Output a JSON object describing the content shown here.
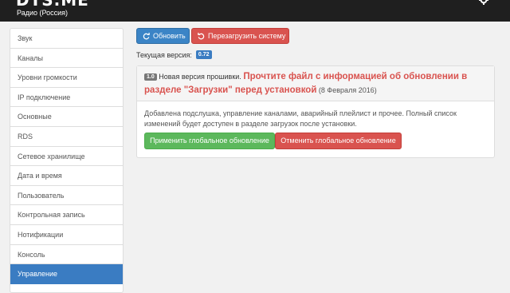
{
  "header": {
    "brand": "DTS.ME",
    "subtitle": "Радио (Россия)"
  },
  "sidebar": {
    "items": [
      {
        "label": "Звук"
      },
      {
        "label": "Каналы"
      },
      {
        "label": "Уровни громкости"
      },
      {
        "label": "IP подключение"
      },
      {
        "label": "Основные"
      },
      {
        "label": "RDS"
      },
      {
        "label": "Сетевое хранилище"
      },
      {
        "label": "Дата и время"
      },
      {
        "label": "Пользователь"
      },
      {
        "label": "Контрольная запись"
      },
      {
        "label": "Нотификации"
      },
      {
        "label": "Консоль"
      },
      {
        "label": "Управление",
        "active": true
      }
    ]
  },
  "toolbar": {
    "refresh_label": "Обновить",
    "reboot_label": "Перезагрузить систему",
    "refresh_icon": "refresh-icon",
    "reboot_icon": "reboot-icon"
  },
  "version": {
    "label": "Текущая версия:",
    "value": "0.72"
  },
  "update_panel": {
    "new_version_badge": "1.0",
    "new_version_text": "Новая версия прошивки.",
    "warning": "Прочтите файл с информацией об обновлении в разделе \"Загрузки\" перед установкой",
    "date": "(8 Февраля 2016)",
    "description": "Добавлена подслушка, управление каналами, аварийный плейлист и прочее. Полный список изменений будет доступен в разделе загрузок после установки.",
    "apply_label": "Применить глобальное обновление",
    "cancel_label": "Отменить глобальное обновление"
  },
  "colors": {
    "primary": "#3b84c6",
    "danger": "#d9534f",
    "success": "#5cb85c",
    "topbar": "#1f1f1f"
  }
}
